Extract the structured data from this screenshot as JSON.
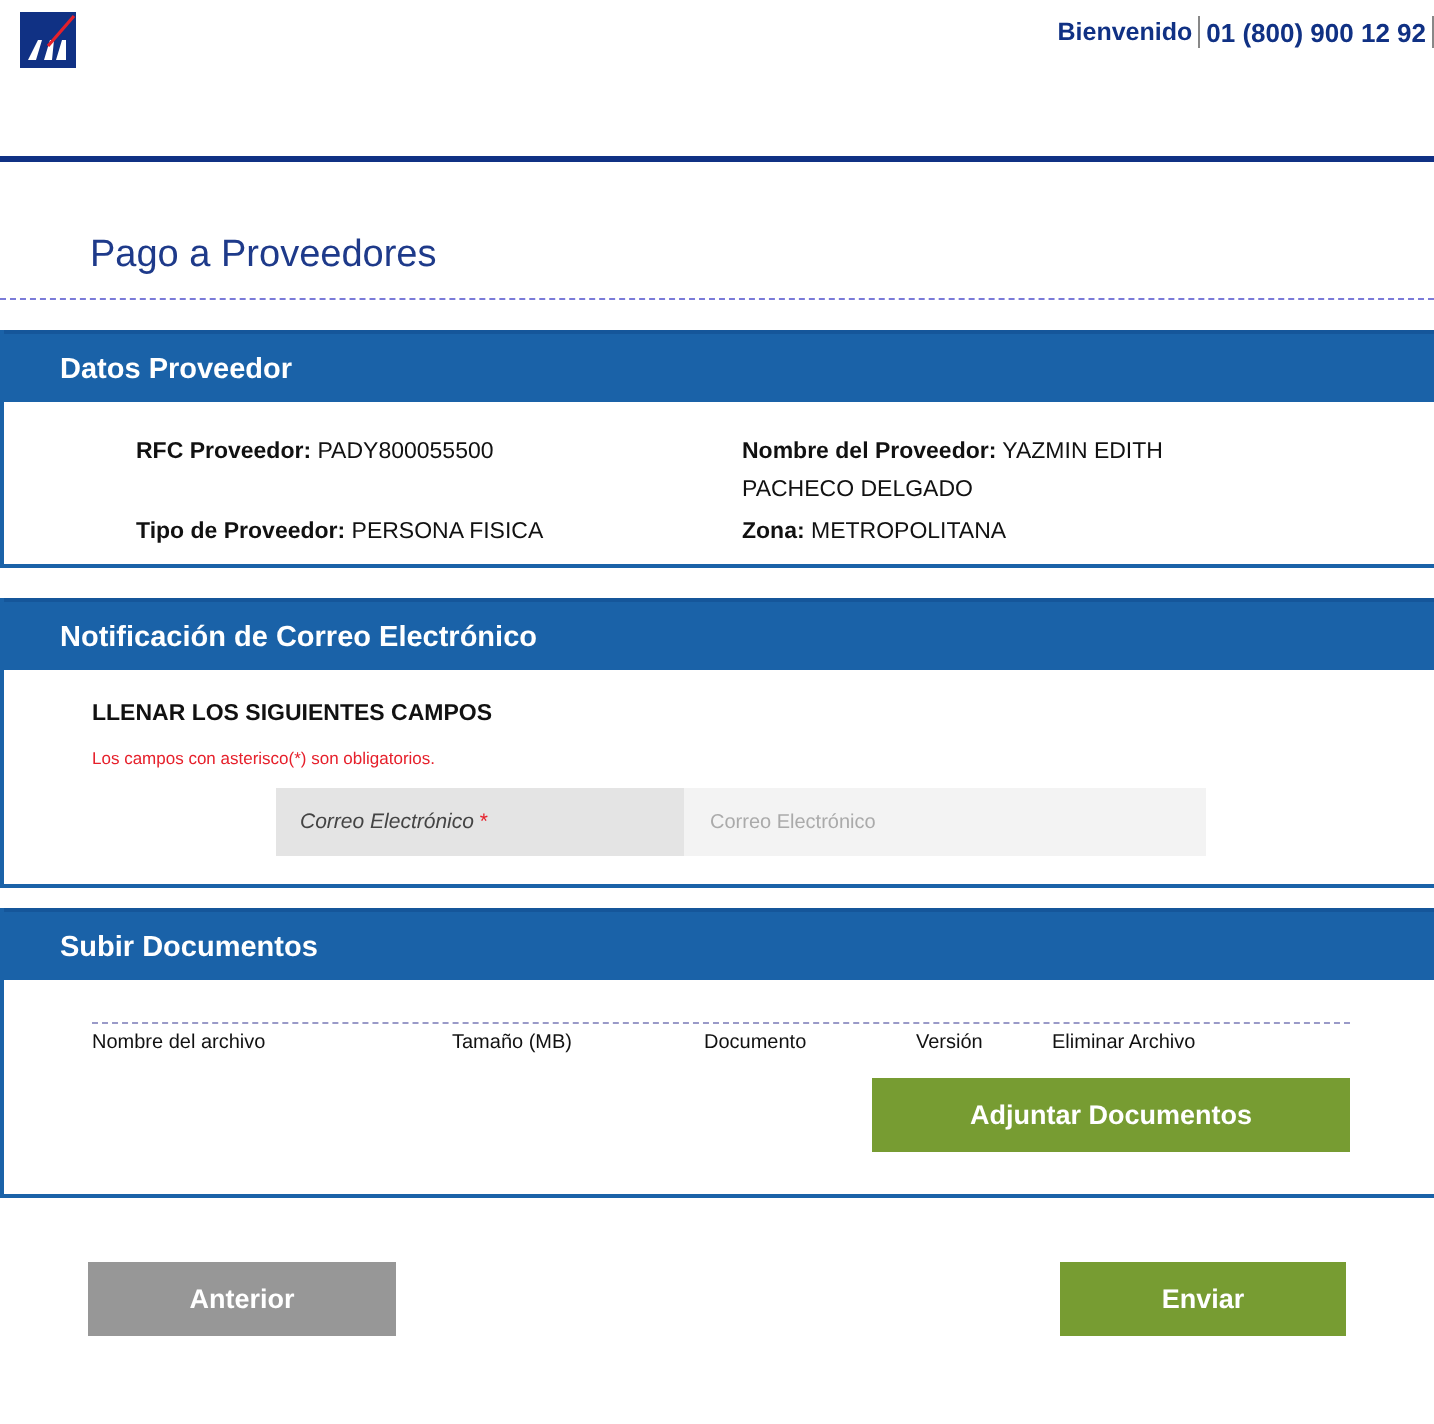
{
  "header": {
    "welcome": "Bienvenido",
    "phone": "01 (800) 900 12 92"
  },
  "page_title": "Pago a Proveedores",
  "provider_section": {
    "title": "Datos Proveedor",
    "fields": [
      {
        "label": "RFC Proveedor:",
        "value": "PADY800055500"
      },
      {
        "label": "Nombre del Proveedor:",
        "value": "YAZMIN EDITH PACHECO DELGADO"
      },
      {
        "label": "Tipo de Proveedor:",
        "value": "PERSONA FISICA"
      },
      {
        "label": "Zona:",
        "value": "METROPOLITANA"
      }
    ]
  },
  "email_section": {
    "title": "Notificación de Correo Electrónico",
    "instruction": "LLENAR LOS SIGUIENTES CAMPOS",
    "required_note": "Los campos con asterisco(*) son obligatorios.",
    "email_field": {
      "label": "Correo Electrónico",
      "required_mark": "*",
      "placeholder": "Correo Electrónico"
    }
  },
  "upload_section": {
    "title": "Subir Documentos",
    "columns": [
      "Nombre del archivo",
      "Tamaño (MB)",
      "Documento",
      "Versión",
      "Eliminar Archivo"
    ],
    "attach_button": "Adjuntar Documentos"
  },
  "buttons": {
    "previous": "Anterior",
    "submit": "Enviar"
  }
}
